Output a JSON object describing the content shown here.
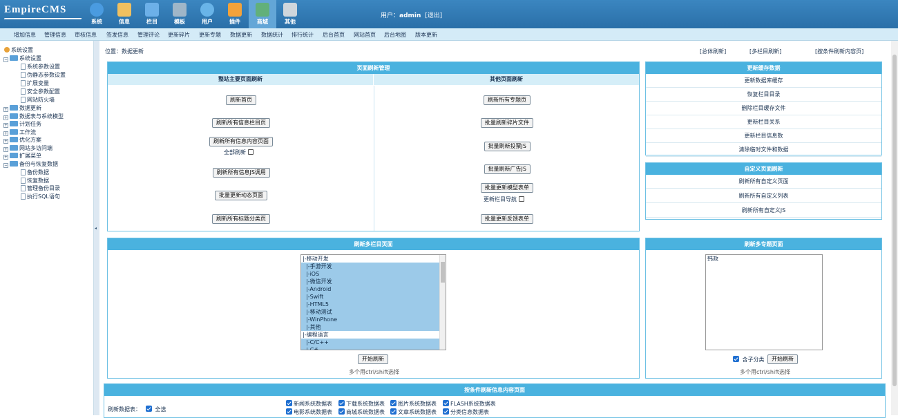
{
  "app": {
    "logo": "EmpireCMS",
    "user_label": "用户：",
    "user_name": "admin",
    "logout": "[退出]"
  },
  "nav": [
    "系统",
    "信息",
    "栏目",
    "模板",
    "用户",
    "插件",
    "商城",
    "其他"
  ],
  "nav_active": 6,
  "menu": [
    "增加信息",
    "管理信息",
    "审核信息",
    "签发信息",
    "管理评论",
    "更新碎片",
    "更新专题",
    "数据更新",
    "数据统计",
    "排行统计",
    "后台首页",
    "网站首页",
    "后台地图",
    "版本更新"
  ],
  "sidebar": {
    "root": "系统设置",
    "sys": "系统设置",
    "sys_items": [
      "系统参数设置",
      "伪静态参数设置",
      "扩展变量",
      "安全参数配置",
      "网站防火墙"
    ],
    "groups": [
      "数据更新",
      "数据表与系统模型",
      "计划任务",
      "工作流",
      "优化方案",
      "网站多访问端",
      "扩展菜单"
    ],
    "backup": "备份与恢复数据",
    "backup_items": [
      "备份数据",
      "恢复数据",
      "管理备份目录",
      "执行SQL语句"
    ]
  },
  "location": "位置：数据更新",
  "top_links": [
    "[总体刷新]",
    "[多栏目刷新]",
    "[按条件刷新内容页]"
  ],
  "page_refresh": {
    "title": "页面刷新管理",
    "left_head": "整站主要页面刷新",
    "right_head": "其他页面刷新",
    "left_btns": [
      "刷新首页",
      "刷新所有信息栏目页",
      "刷新所有信息内容页面",
      "刷新所有信息JS调用",
      "批量更新动态页面",
      "刷新所有标题分类页"
    ],
    "all_refresh": "全部刷新",
    "right_btns": [
      "刷新所有专题页",
      "批量刷新碎片文件",
      "批量刷新投票JS",
      "批量刷新广告JS",
      "批量更新模型表单",
      "批量更新反馈表单"
    ],
    "nav_update": "更新栏目导航"
  },
  "cache": {
    "title": "更新缓存数据",
    "items": [
      "更新数据库缓存",
      "恢复栏目目录",
      "删除栏目缓存文件",
      "更新栏目关系",
      "更新栏目信息数",
      "清除临时文件和数据"
    ]
  },
  "custom": {
    "title": "自定义页面刷新",
    "items": [
      "刷新所有自定义页面",
      "刷新所有自定义列表",
      "刷新所有自定义JS"
    ]
  },
  "multi_class": {
    "title": "刷新多栏目页面",
    "options": [
      "|-移动开发",
      "|-手游开发",
      "|-iOS",
      "|-微信开发",
      "|-Android",
      "|-Swift",
      "|-HTML5",
      "|-移动测试",
      "|-WinPhone",
      "|-其他",
      "|-编程语言",
      "|-C/C++",
      "|-C#"
    ],
    "selected": [
      1,
      2,
      3,
      4,
      5,
      6,
      7,
      8,
      9,
      11,
      12
    ],
    "start": "开始刷新",
    "hint": "多个用ctrl/shift选择"
  },
  "multi_special": {
    "title": "刷新多专题页面",
    "options": [
      "韩政"
    ],
    "include_sub": "含子分类",
    "start": "开始刷新",
    "hint": "多个用ctrl/shift选择"
  },
  "cond": {
    "title": "按条件刷新信息内容页面",
    "label": "刷新数据表：",
    "all": "全选",
    "tables": [
      "新闻系统数据表",
      "下载系统数据表",
      "图片系统数据表",
      "FLASH系统数据表",
      "电影系统数据表",
      "商城系统数据表",
      "文章系统数据表",
      "分类信息数据表"
    ]
  },
  "colors": {
    "header": "#2f78b2",
    "panel_head": "#4ab2df",
    "sub_head": "#d5eef8",
    "menu_bg": "#d4ebf7",
    "selected": "#9ccae9"
  }
}
